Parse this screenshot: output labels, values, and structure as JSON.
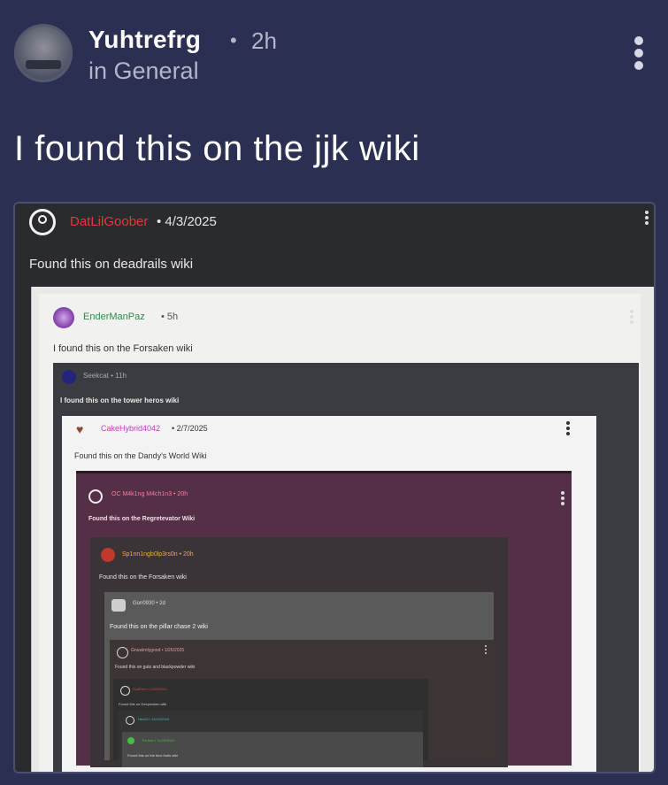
{
  "post": {
    "username": "Yuhtrefrg",
    "separator": "•",
    "time": "2h",
    "community": "in General",
    "title": "I found this on the jjk wiki"
  },
  "nested": {
    "l1": {
      "user": "DatLilGoober",
      "date": "• 4/3/2025",
      "text": "Found this on deadrails wiki"
    },
    "l2": {
      "user": "EnderManPaz",
      "time": "• 5h",
      "text": "I found this on the Forsaken wiki"
    },
    "l3": {
      "user": "Seekcat • 11h",
      "text": "I found this on the tower heros wiki"
    },
    "l4": {
      "user": "CakeHybrid4042",
      "date": "• 2/7/2025",
      "text": "Found this on the Dandy's World Wiki"
    },
    "l5": {
      "user": "OC M4k1ng M4ch1n3 • 20h",
      "text": "Found this on the Regretevator Wiki"
    },
    "l6": {
      "user": "Sp1nn1ngb0lp3rs0n • 20h",
      "text": "Found this on the Forsaken wiki"
    },
    "l7": {
      "user": "Gon0930 • 2d",
      "text": "Found this on the pillar chase 2 wiki"
    },
    "l8": {
      "user": "Gnuwirelygood • 1/26/2025",
      "text": "Found this on guts and blackpowder wiki"
    },
    "l9": {
      "user": "ScaFeet • 12/29/2024",
      "text": "Found this on Deepwoken wiki"
    },
    "l10": {
      "user": "Hex20 • 12/12/2024"
    },
    "l11": {
      "user": "Tro.bee • 11/25/2024",
      "text": "Found this on the blox fruits wiki"
    }
  },
  "icons": {
    "avatar": "avatar-image",
    "more": "vertical-dots-icon",
    "user": "user-circle-icon"
  }
}
